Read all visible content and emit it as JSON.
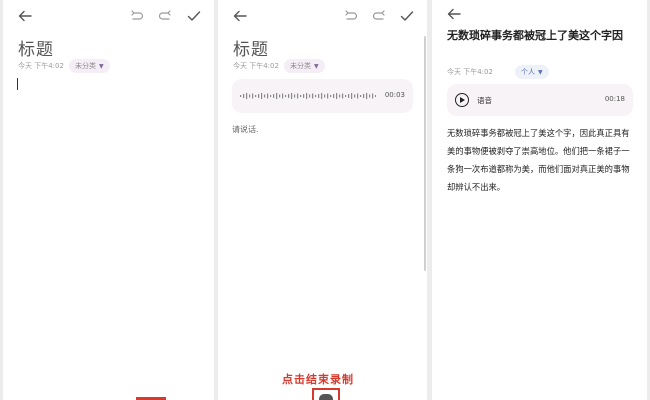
{
  "panel1": {
    "title": "标题",
    "date": "今天 下午4:02",
    "category": "未分类"
  },
  "panel2": {
    "title": "标题",
    "date": "今天 下午4:02",
    "category": "未分类",
    "record_time": "00:03",
    "hint": "请说话.",
    "callout": "点击结束录制"
  },
  "panel3": {
    "title": "无数琐碎事务都被冠上了美这个字因",
    "date": "今天 下午4:02",
    "category": "个人",
    "audio_label": "语音",
    "audio_time": "00:18",
    "body": "无数琐碎事务都被冠上了美这个字，因此真正具有美的事物便被剥夺了崇高地位。他们把一条裙子一条狗一次布道都称为美，而他们面对真正美的事物却辨认不出来。"
  },
  "icons": [
    "back-arrow-icon",
    "undo-icon",
    "redo-icon",
    "check-icon",
    "play-icon",
    "caret-down-icon",
    "stop-record-icon"
  ],
  "colors": {
    "accent_red": "#d63a2e",
    "card_bg": "#f7f3f6",
    "tag_blue": "#5a74b0"
  }
}
